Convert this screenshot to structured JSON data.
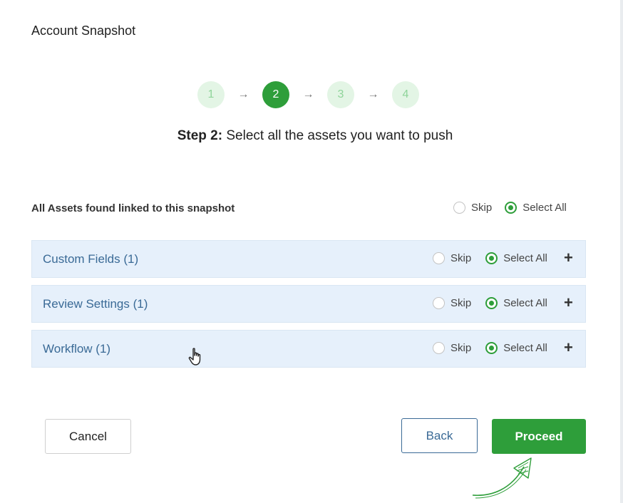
{
  "dialog": {
    "title": "Account Snapshot"
  },
  "stepper": {
    "steps": [
      "1",
      "2",
      "3",
      "4"
    ],
    "active_index": 1,
    "arrow": "→"
  },
  "step_description": {
    "bold": "Step 2:",
    "text": "Select all the assets you want to push"
  },
  "assets": {
    "heading": "All Assets found linked to this snapshot",
    "options": {
      "skip": "Skip",
      "select_all": "Select All",
      "selected": "select_all"
    },
    "rows": [
      {
        "label": "Custom Fields (1)",
        "skip": "Skip",
        "select_all": "Select All",
        "selected": "select_all",
        "expand": "+"
      },
      {
        "label": "Review Settings (1)",
        "skip": "Skip",
        "select_all": "Select All",
        "selected": "select_all",
        "expand": "+"
      },
      {
        "label": "Workflow (1)",
        "skip": "Skip",
        "select_all": "Select All",
        "selected": "select_all",
        "expand": "+"
      }
    ]
  },
  "footer": {
    "cancel_label": "Cancel",
    "back_label": "Back",
    "proceed_label": "Proceed"
  },
  "colors": {
    "accent_green": "#2e9e3a",
    "row_bg": "#e6f0fb",
    "link_blue": "#3a6a96"
  },
  "icons": {
    "cursor": "hand-pointer-icon",
    "annotation": "green-arrow-icon",
    "expand": "plus-icon"
  }
}
